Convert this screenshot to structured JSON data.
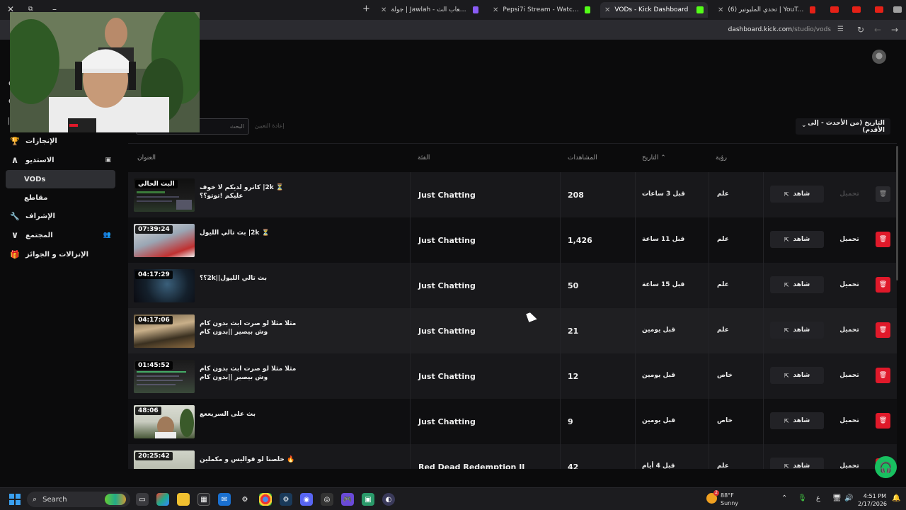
{
  "browser": {
    "window_close": "✕",
    "new_tab": "+",
    "tabs": [
      {
        "label": "جولة | Jawlah - منصة الألعاب الت",
        "active": false
      },
      {
        "label": "Pepsi7i Stream - Watch Live on",
        "active": false
      },
      {
        "label": "VODs - Kick Dashboard",
        "active": true
      },
      {
        "label": "(6) تحدي المليونير | YouTube - ...e",
        "active": false
      }
    ],
    "url_host": "dashboard.kick.com",
    "url_path": "/studio/vods"
  },
  "sidebar": {
    "items": [
      {
        "label": "الإنجازات",
        "icon": "trophy-icon",
        "glyph": "🏆",
        "active": false
      },
      {
        "label": "الاستديو",
        "icon": "chevron-up-icon",
        "glyph": "⌃",
        "active": false
      },
      {
        "label": "VODs",
        "icon": "",
        "glyph": "",
        "active": true
      },
      {
        "label": "مقاطع",
        "icon": "",
        "glyph": "",
        "active": false
      },
      {
        "label": "الإشراف",
        "icon": "wrench-icon",
        "glyph": "🔧",
        "active": false
      },
      {
        "label": "المجتمع",
        "icon": "chevron-down-icon",
        "glyph": "⌄",
        "active": false
      },
      {
        "label": "الإنزالات و الجوائز",
        "icon": "gift-icon",
        "glyph": "🎁",
        "active": false
      }
    ]
  },
  "toolbar": {
    "search_placeholder": "البحث",
    "reset_label": "إعادة التعيين",
    "sort_label": "التاريخ (من الأحدث - إلى الأقدم)"
  },
  "table": {
    "headers": {
      "title": "العنوان",
      "category": "الفئة",
      "views": "المشاهدات",
      "date": "التاريخ",
      "visibility": "رؤية"
    },
    "watch_label": "شاهد",
    "download_label": "تحميل",
    "rows": [
      {
        "duration": "البث الحالي",
        "title": "⏳ 2k| كاترو لديكم لا خوف عليكم !توتو؟؟",
        "category": "Just Chatting",
        "views": "208",
        "date": "قبل 3 ساعات",
        "visibility": "علم",
        "download_enabled": false
      },
      {
        "duration": "07:39:24",
        "title": "⏳ 2k| بث تالي الليول",
        "category": "Just Chatting",
        "views": "1,426",
        "date": "قبل 11 ساعة",
        "visibility": "علم",
        "download_enabled": true
      },
      {
        "duration": "04:17:29",
        "title": "بث تالي الليول||2k؟؟",
        "category": "Just Chatting",
        "views": "50",
        "date": "قبل 15 ساعة",
        "visibility": "علم",
        "download_enabled": true
      },
      {
        "duration": "04:17:06",
        "title": "مثلا مثلا لو صرت ابث بدون كام وش بيصير ||بدون كام",
        "category": "Just Chatting",
        "views": "21",
        "date": "قبل يومين",
        "visibility": "علم",
        "download_enabled": true
      },
      {
        "duration": "01:45:52",
        "title": "مثلا مثلا لو صرت ابث بدون كام وش بيصير ||بدون كام",
        "category": "Just Chatting",
        "views": "12",
        "date": "قبل يومين",
        "visibility": "خاص",
        "download_enabled": true
      },
      {
        "duration": "48:06",
        "title": "بث على السريععع",
        "category": "Just Chatting",
        "views": "9",
        "date": "قبل يومين",
        "visibility": "خاص",
        "download_enabled": true
      },
      {
        "duration": "20:25:42",
        "title": "🔥 خلصنا لو قواليس و مكملين",
        "category": "Red Dead Redemption II",
        "views": "42",
        "date": "قبل 4 أيام",
        "visibility": "علم",
        "download_enabled": true
      }
    ]
  },
  "taskbar": {
    "search_label": "Search",
    "weather_badge": "2",
    "weather_temp": "88°F",
    "weather_desc": "Sunny",
    "lang": "ع",
    "time": "4:51 PM",
    "date": "2/17/2026"
  },
  "colors": {
    "accent_green": "#53fc18",
    "delete_red": "#e0192a",
    "background": "#0b0b0c"
  }
}
